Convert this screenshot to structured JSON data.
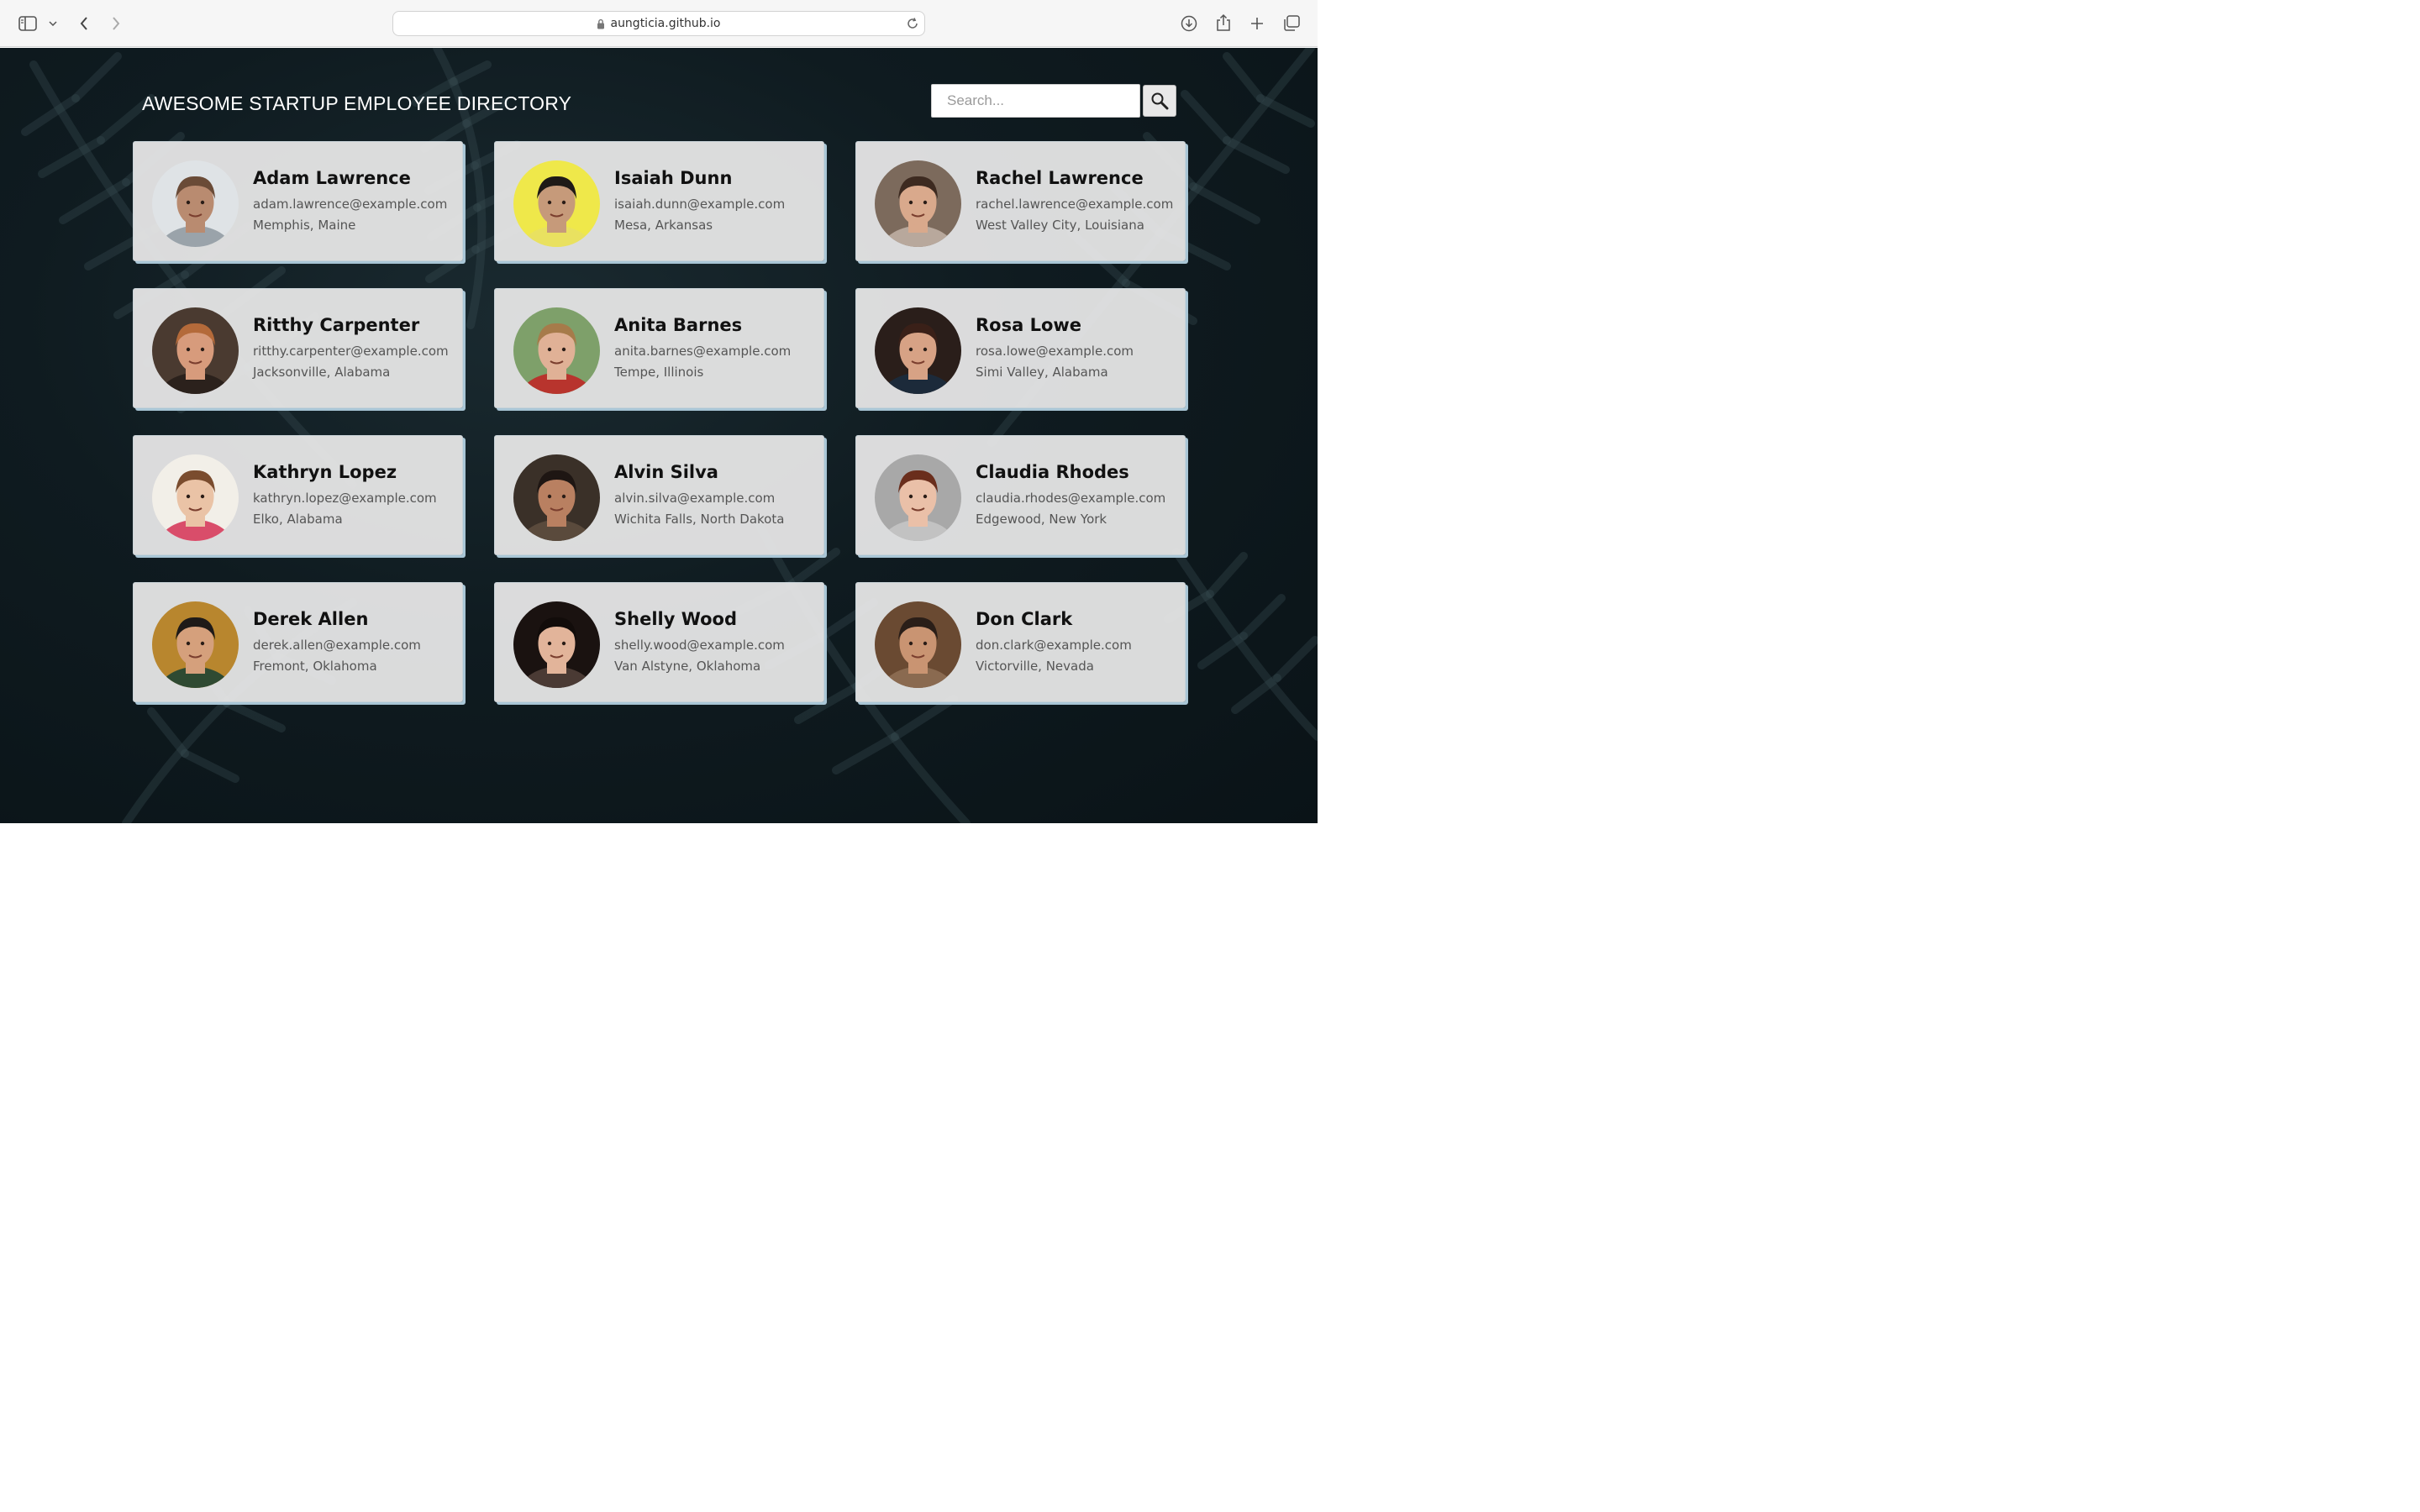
{
  "browser": {
    "url": "aungticia.github.io"
  },
  "page": {
    "title": "AWESOME STARTUP EMPLOYEE DIRECTORY",
    "search": {
      "placeholder": "Search..."
    }
  },
  "employees": [
    {
      "name": "Adam Lawrence",
      "email": "adam.lawrence@example.com",
      "location": "Memphis, Maine",
      "avatar_colors": [
        "#dfe3e6",
        "#b98b70",
        "#6a4b37",
        "#9aa3aa"
      ]
    },
    {
      "name": "Isaiah Dunn",
      "email": "isaiah.dunn@example.com",
      "location": "Mesa, Arkansas",
      "avatar_colors": [
        "#efe84a",
        "#c69a7a",
        "#1f1a17",
        "#e9e160"
      ]
    },
    {
      "name": "Rachel Lawrence",
      "email": "rachel.lawrence@example.com",
      "location": "West Valley City, Louisiana",
      "avatar_colors": [
        "#7c6a5c",
        "#d9a98c",
        "#3d2a20",
        "#b8a89c"
      ]
    },
    {
      "name": "Ritthy Carpenter",
      "email": "ritthy.carpenter@example.com",
      "location": "Jacksonville, Alabama",
      "avatar_colors": [
        "#4a3a30",
        "#d79b7c",
        "#b46a3a",
        "#2b211c"
      ]
    },
    {
      "name": "Anita Barnes",
      "email": "anita.barnes@example.com",
      "location": "Tempe, Illinois",
      "avatar_colors": [
        "#7ea06a",
        "#e0b196",
        "#a67b4a",
        "#b8342d"
      ]
    },
    {
      "name": "Rosa Lowe",
      "email": "rosa.lowe@example.com",
      "location": "Simi Valley, Alabama",
      "avatar_colors": [
        "#2a1e1a",
        "#d7a285",
        "#3a2018",
        "#1c2a3a"
      ]
    },
    {
      "name": "Kathryn Lopez",
      "email": "kathryn.lopez@example.com",
      "location": "Elko, Alabama",
      "avatar_colors": [
        "#f2efe8",
        "#eac3a6",
        "#7a4c2e",
        "#d94d6a"
      ]
    },
    {
      "name": "Alvin Silva",
      "email": "alvin.silva@example.com",
      "location": "Wichita Falls, North Dakota",
      "avatar_colors": [
        "#3a3028",
        "#b98061",
        "#1e1613",
        "#5a4a3c"
      ]
    },
    {
      "name": "Claudia Rhodes",
      "email": "claudia.rhodes@example.com",
      "location": "Edgewood, New York",
      "avatar_colors": [
        "#a8a8a8",
        "#eac0a8",
        "#6a2e1c",
        "#c2c2c2"
      ]
    },
    {
      "name": "Derek Allen",
      "email": "derek.allen@example.com",
      "location": "Fremont, Oklahoma",
      "avatar_colors": [
        "#b8862e",
        "#d5a07c",
        "#1e1a18",
        "#2f4a32"
      ]
    },
    {
      "name": "Shelly Wood",
      "email": "shelly.wood@example.com",
      "location": "Van Alstyne, Oklahoma",
      "avatar_colors": [
        "#1a1210",
        "#e2b49a",
        "#120c0a",
        "#4a3a34"
      ]
    },
    {
      "name": "Don Clark",
      "email": "don.clark@example.com",
      "location": "Victorville, Nevada",
      "avatar_colors": [
        "#6a4a32",
        "#c99472",
        "#2a1e18",
        "#8a6a50"
      ]
    }
  ]
}
